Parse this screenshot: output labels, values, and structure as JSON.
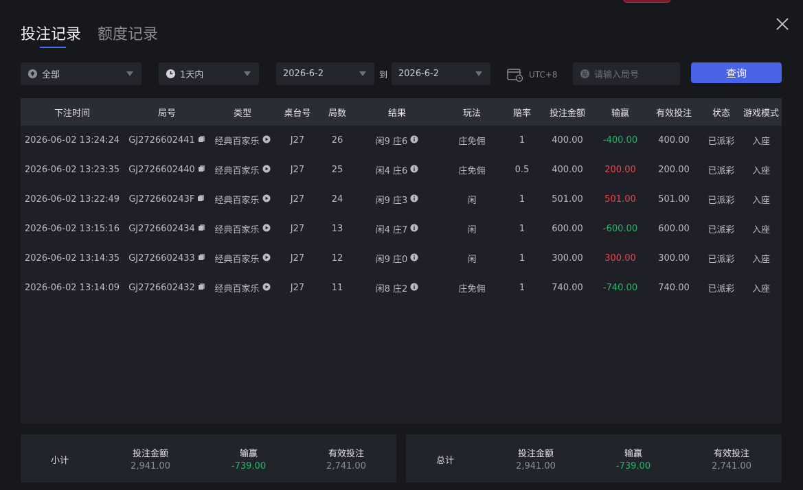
{
  "tabs": [
    {
      "label": "投注记录",
      "active": true
    },
    {
      "label": "额度记录",
      "active": false
    }
  ],
  "filters": {
    "game_type": "全部",
    "time_range": "1天内",
    "date_from": "2026-6-2",
    "to_label": "到",
    "date_to": "2026-6-2",
    "timezone": "UTC+8",
    "round_placeholder": "请输入局号",
    "query_button": "查询"
  },
  "table": {
    "headers": [
      "下注时间",
      "局号",
      "类型",
      "桌台号",
      "局数",
      "结果",
      "玩法",
      "赔率",
      "投注金额",
      "输赢",
      "有效投注",
      "状态",
      "游戏模式"
    ],
    "rows": [
      {
        "time": "2026-06-02 13:24:24",
        "round": "GJ2726602441",
        "type": "经典百家乐",
        "table": "J27",
        "shoe": "26",
        "result": "闲9 庄6",
        "play": "庄免佣",
        "odds": "1",
        "bet": "400.00",
        "winloss": "-400.00",
        "winloss_sign": "neg",
        "valid": "400.00",
        "status": "已派彩",
        "mode": "入座"
      },
      {
        "time": "2026-06-02 13:23:35",
        "round": "GJ2726602440",
        "type": "经典百家乐",
        "table": "J27",
        "shoe": "25",
        "result": "闲4 庄6",
        "play": "庄免佣",
        "odds": "0.5",
        "bet": "400.00",
        "winloss": "200.00",
        "winloss_sign": "pos",
        "valid": "200.00",
        "status": "已派彩",
        "mode": "入座"
      },
      {
        "time": "2026-06-02 13:22:49",
        "round": "GJ272660243F",
        "type": "经典百家乐",
        "table": "J27",
        "shoe": "24",
        "result": "闲9 庄3",
        "play": "闲",
        "odds": "1",
        "bet": "501.00",
        "winloss": "501.00",
        "winloss_sign": "pos",
        "valid": "501.00",
        "status": "已派彩",
        "mode": "入座"
      },
      {
        "time": "2026-06-02 13:15:16",
        "round": "GJ2726602434",
        "type": "经典百家乐",
        "table": "J27",
        "shoe": "13",
        "result": "闲4 庄7",
        "play": "闲",
        "odds": "1",
        "bet": "600.00",
        "winloss": "-600.00",
        "winloss_sign": "neg",
        "valid": "600.00",
        "status": "已派彩",
        "mode": "入座"
      },
      {
        "time": "2026-06-02 13:14:35",
        "round": "GJ2726602433",
        "type": "经典百家乐",
        "table": "J27",
        "shoe": "12",
        "result": "闲9 庄0",
        "play": "闲",
        "odds": "1",
        "bet": "300.00",
        "winloss": "300.00",
        "winloss_sign": "pos",
        "valid": "300.00",
        "status": "已派彩",
        "mode": "入座"
      },
      {
        "time": "2026-06-02 13:14:09",
        "round": "GJ2726602432",
        "type": "经典百家乐",
        "table": "J27",
        "shoe": "11",
        "result": "闲8 庄2",
        "play": "庄免佣",
        "odds": "1",
        "bet": "740.00",
        "winloss": "-740.00",
        "winloss_sign": "neg",
        "valid": "740.00",
        "status": "已派彩",
        "mode": "入座"
      }
    ]
  },
  "subtotal": {
    "label": "小计",
    "bet_label": "投注金额",
    "bet": "2,941.00",
    "winloss_label": "输赢",
    "winloss": "-739.00",
    "valid_label": "有效投注",
    "valid": "2,741.00"
  },
  "total": {
    "label": "总计",
    "bet_label": "投注金额",
    "bet": "2,941.00",
    "winloss_label": "输赢",
    "winloss": "-739.00",
    "valid_label": "有效投注",
    "valid": "2,741.00"
  },
  "colors": {
    "accent": "#4a63e7",
    "loss": "#1fb865",
    "win": "#e74848"
  }
}
